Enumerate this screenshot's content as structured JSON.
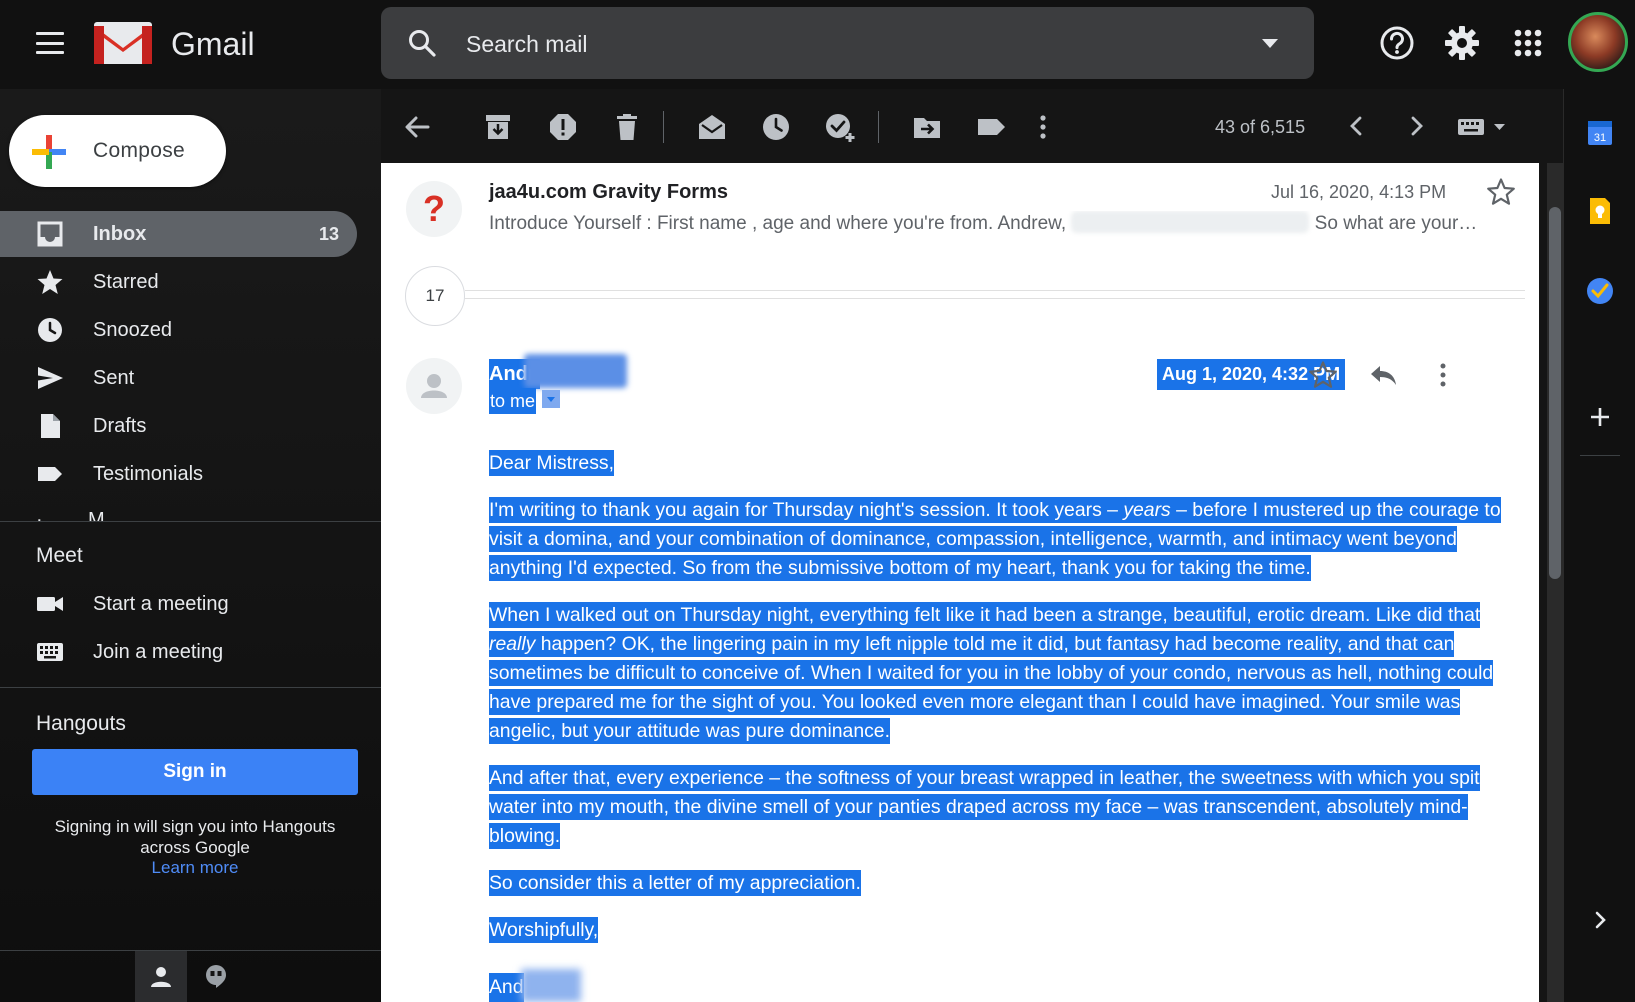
{
  "app": {
    "brand": "Gmail",
    "menu_icon": "hamburger-menu-icon",
    "logo_icon": "gmail-logo-icon"
  },
  "search": {
    "placeholder": "Search mail",
    "icon": "search-icon",
    "options_icon": "search-options-caret-icon"
  },
  "header_icons": [
    "help-icon",
    "settings-gear-icon",
    "apps-grid-icon",
    "account-avatar"
  ],
  "compose": {
    "label": "Compose",
    "icon": "compose-plus-icon"
  },
  "nav": {
    "items": [
      {
        "label": "Inbox",
        "count": "13",
        "icon": "inbox-icon",
        "active": true
      },
      {
        "label": "Starred",
        "count": "",
        "icon": "star-icon",
        "active": false
      },
      {
        "label": "Snoozed",
        "count": "",
        "icon": "clock-icon",
        "active": false
      },
      {
        "label": "Sent",
        "count": "",
        "icon": "send-icon",
        "active": false
      },
      {
        "label": "Drafts",
        "count": "",
        "icon": "draft-file-icon",
        "active": false
      },
      {
        "label": "Testimonials",
        "count": "",
        "icon": "label-tag-icon",
        "active": false
      }
    ],
    "more_partial": "M"
  },
  "meet": {
    "title": "Meet",
    "items": [
      {
        "label": "Start a meeting",
        "icon": "video-camera-icon"
      },
      {
        "label": "Join a meeting",
        "icon": "keyboard-icon"
      }
    ]
  },
  "hangouts": {
    "title": "Hangouts",
    "sign_in_label": "Sign in",
    "note": "Signing in will sign you into Hangouts across Google",
    "learn_more": "Learn more",
    "tabs": [
      "contacts-person-icon",
      "hangouts-chat-icon"
    ]
  },
  "toolbar": {
    "icons": [
      "back-arrow-icon",
      "archive-icon",
      "report-spam-icon",
      "delete-trash-icon",
      "mark-unread-envelope-icon",
      "snooze-clock-icon",
      "add-to-tasks-icon",
      "move-to-folder-icon",
      "label-icon",
      "more-vertical-icon"
    ],
    "pager_text": "43 of 6,515",
    "pager_icons": [
      "newer-chevron-left-icon",
      "older-chevron-right-icon",
      "input-tools-keyboard-icon"
    ]
  },
  "thread": {
    "first_message": {
      "sender": "jaa4u.com Gravity Forms",
      "date": "Jul 16, 2020, 4:13 PM",
      "snippet_start": "Introduce Yourself : First name , age and where you're from. Andrew,",
      "snippet_end": "So what are your…",
      "avatar_text": "?"
    },
    "collapsed_count": "17",
    "open_message": {
      "sender_visible": "Andr",
      "recipient": "to me",
      "date": "Aug 1, 2020, 4:32 PM",
      "greeting": "Dear Mistress,",
      "para1_before": "I'm writing to thank you again for Thursday night's session. It took years – ",
      "para1_em": "years",
      "para1_after": " – before I mustered up the courage to visit a domina, and your combination of dominance, compassion, intelligence, warmth, and intimacy went beyond anything I'd expected. So from the submissive bottom of my heart, thank you for taking the time.",
      "para2_before": "When I walked out on Thursday night, everything felt like it had been a strange, beautiful, erotic dream. Like did that ",
      "para2_em": "really",
      "para2_after": " happen? OK, the lingering pain in my left nipple told me it did, but fantasy had become reality, and that can sometimes be difficult to conceive of. When I waited for you in the lobby of your condo, nervous as hell, nothing could have prepared me for the sight of you. You looked even more elegant than I could have imagined. Your smile was angelic, but your attitude was pure dominance.",
      "para3": "And after that, every experience – the softness of your breast wrapped in leather, the sweetness with which you spit water into my mouth, the divine smell of your panties draped across my face – was transcendent, absolutely mind-blowing.",
      "para4": "So consider this a letter of my appreciation.",
      "closing": "Worshipfully,",
      "signature_visible": "And"
    }
  },
  "right_panel": {
    "icons": [
      "google-calendar-icon",
      "google-keep-icon",
      "google-tasks-icon",
      "get-addons-plus-icon",
      "expand-side-panel-chevron-icon"
    ]
  },
  "colors": {
    "highlight": "#1a73e8",
    "sign_in": "#3b82f6",
    "active_nav": "#5f6368",
    "spam_red": "#d93025"
  }
}
